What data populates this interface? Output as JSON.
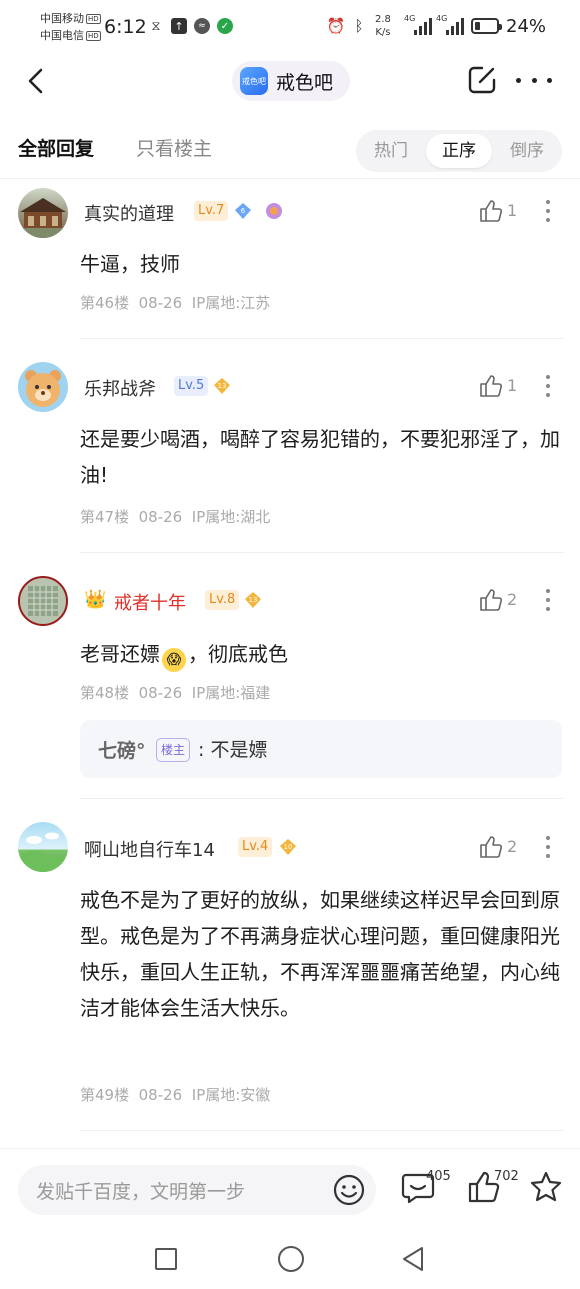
{
  "status_bar": {
    "carrier1": "中国移动",
    "carrier2": "中国电信",
    "hd": "HD",
    "time": "6:12",
    "net_speed": "2.8",
    "net_unit": "K/s",
    "signal1": "4G",
    "signal2": "4G",
    "battery_pct": "24%",
    "battery_level": 0.24
  },
  "nav": {
    "bar_icon_text": "戒色吧",
    "bar_name": "戒色吧"
  },
  "tabs": {
    "all_replies": "全部回复",
    "owner_only": "只看楼主",
    "sort_hot": "热门",
    "sort_asc": "正序",
    "sort_desc": "倒序"
  },
  "posts": [
    {
      "username": "真实的道理",
      "level": "Lv.7",
      "likes": "1",
      "content": "牛逼，技师",
      "floor": "第46楼",
      "date": "08-26",
      "ip": "IP属地:江苏"
    },
    {
      "username": "乐邦战斧",
      "level": "Lv.5",
      "badge_num": "13",
      "likes": "1",
      "content": "还是要少喝酒，喝醉了容易犯错的，不要犯邪淫了，加油!",
      "floor": "第47楼",
      "date": "08-26",
      "ip": "IP属地:湖北"
    },
    {
      "username": "戒者十年",
      "level": "Lv.8",
      "badge_num": "13",
      "likes": "2",
      "content": "老哥还嫖",
      "content2": "，彻底戒色",
      "floor": "第48楼",
      "date": "08-26",
      "ip": "IP属地:福建",
      "reply": {
        "name": "七磅°",
        "tag": "楼主",
        "text": ":  不是嫖"
      }
    },
    {
      "username": "啊山地自行车14",
      "level": "Lv.4",
      "badge_num": "10",
      "likes": "2",
      "content": "戒色不是为了更好的放纵，如果继续这样迟早会回到原型。戒色是为了不再满身症状心理问题，重回健康阳光快乐，重回人生正轨，不再浑浑噩噩痛苦绝望，内心纯洁才能体会生活大快乐。",
      "floor": "第49楼",
      "date": "08-26",
      "ip": "IP属地:安徽"
    }
  ],
  "bottom": {
    "placeholder": "发贴千百度，文明第一步",
    "comment_count": "405",
    "like_count": "702"
  }
}
